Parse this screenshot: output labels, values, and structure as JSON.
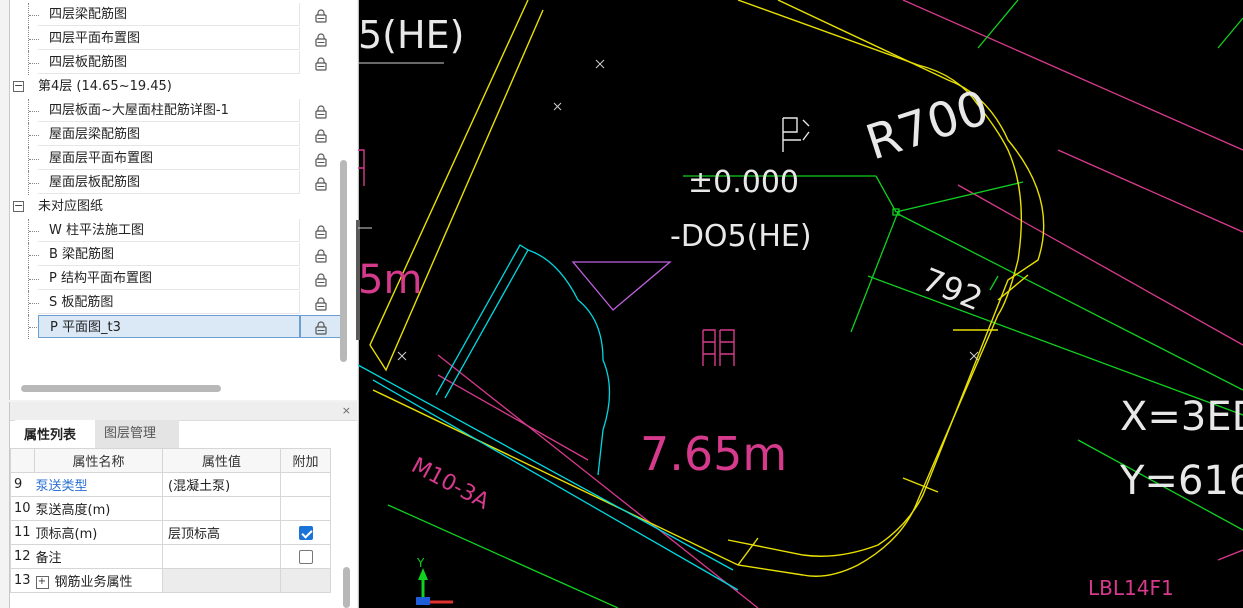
{
  "tree": {
    "items": [
      {
        "type": "child",
        "label": "四层梁配筋图"
      },
      {
        "type": "child",
        "label": "四层平面布置图"
      },
      {
        "type": "child",
        "label": "四层板配筋图"
      },
      {
        "type": "group",
        "label": "第4层 (14.65~19.45)",
        "toggle": "−"
      },
      {
        "type": "child",
        "label": "四层板面~大屋面柱配筋详图-1"
      },
      {
        "type": "child",
        "label": "屋面层梁配筋图"
      },
      {
        "type": "child",
        "label": "屋面层平面布置图"
      },
      {
        "type": "child",
        "label": "屋面层板配筋图"
      },
      {
        "type": "group",
        "label": "未对应图纸",
        "toggle": "−"
      },
      {
        "type": "child",
        "label": "W 柱平法施工图"
      },
      {
        "type": "child",
        "label": "B 梁配筋图"
      },
      {
        "type": "child",
        "label": "P 结构平面布置图"
      },
      {
        "type": "child",
        "label": "S 板配筋图"
      },
      {
        "type": "child",
        "label": "P 平面图_t3",
        "selected": true
      }
    ]
  },
  "props": {
    "close": "×",
    "tabs": [
      "属性列表",
      "图层管理"
    ],
    "headers": [
      "属性名称",
      "属性值",
      "附加"
    ],
    "rows": [
      {
        "idx": "9",
        "name": "泵送类型",
        "value": "(混凝土泵)",
        "link": true,
        "check": null
      },
      {
        "idx": "10",
        "name": "泵送高度(m)",
        "value": "",
        "link": false,
        "check": null
      },
      {
        "idx": "11",
        "name": "顶标高(m)",
        "value": "层顶标高",
        "link": false,
        "check": true
      },
      {
        "idx": "12",
        "name": "备注",
        "value": "",
        "link": false,
        "check": false
      },
      {
        "idx": "13",
        "name": "钢筋业务属性",
        "value": "",
        "link": false,
        "check": null,
        "expander": "+",
        "gray": true
      }
    ]
  },
  "cad": {
    "texts": {
      "t1": "5(HE)",
      "t2": "R700",
      "t3": "±0.000",
      "t4": "-DO5(HE)",
      "t5": "792",
      "t6": "5m",
      "t7": "7.65m",
      "t8": "M10-3A",
      "t9": "X=3ED",
      "t10": "Y=616",
      "t11": "LBL14F1",
      "t12": "Y"
    },
    "colors": {
      "yellow": "#e8e000",
      "cyan": "#00d8e0",
      "magenta": "#d63a8c",
      "green": "#10d020",
      "violet": "#c060e0",
      "white": "#e8e8e8",
      "red_text": "#e05070"
    }
  }
}
